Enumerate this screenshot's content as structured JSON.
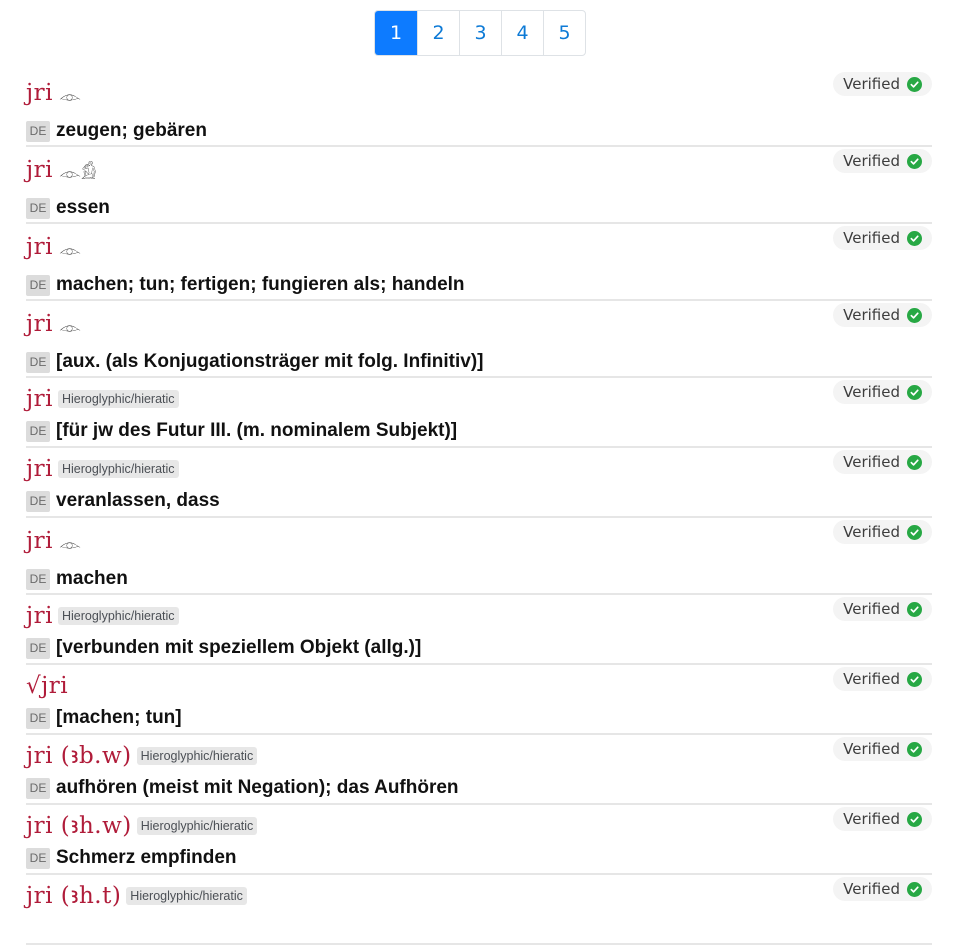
{
  "pagination": {
    "pages": [
      "1",
      "2",
      "3",
      "4",
      "5"
    ],
    "active": "1"
  },
  "status_color": "#27a844",
  "accent_color": "#0d7bff",
  "lemma_color": "#b01c3a",
  "entries": [
    {
      "lemma": "jri",
      "glyphs": "𓁹",
      "badge": "",
      "status": "Verified",
      "lang": "DE",
      "translation": "zeugen; gebären",
      "size": "tall"
    },
    {
      "lemma": "jri",
      "glyphs": "𓁹𓀁",
      "badge": "",
      "status": "Verified",
      "lang": "DE",
      "translation": "essen",
      "size": "tall"
    },
    {
      "lemma": "jri",
      "glyphs": "𓁹",
      "badge": "",
      "status": "Verified",
      "lang": "DE",
      "translation": "machen; tun; fertigen; fungieren als; handeln",
      "size": "tall"
    },
    {
      "lemma": "jri",
      "glyphs": "𓁹",
      "badge": "",
      "status": "Verified",
      "lang": "DE",
      "translation": "[aux. (als Konjugationsträger mit folg. Infinitiv)]",
      "size": "tall"
    },
    {
      "lemma": "jri",
      "glyphs": "",
      "badge": "Hieroglyphic/hieratic",
      "status": "Verified",
      "lang": "DE",
      "translation": "[für jw des Futur III. (m. nominalem Subjekt)]",
      "size": "short"
    },
    {
      "lemma": "jri",
      "glyphs": "",
      "badge": "Hieroglyphic/hieratic",
      "status": "Verified",
      "lang": "DE",
      "translation": "veranlassen, dass",
      "size": "short"
    },
    {
      "lemma": "jri",
      "glyphs": "𓁹",
      "badge": "",
      "status": "Verified",
      "lang": "DE",
      "translation": "machen",
      "size": "tall"
    },
    {
      "lemma": "jri",
      "glyphs": "",
      "badge": "Hieroglyphic/hieratic",
      "status": "Verified",
      "lang": "DE",
      "translation": "[verbunden mit speziellem Objekt (allg.)]",
      "size": "short"
    },
    {
      "lemma": "√jri",
      "glyphs": "",
      "badge": "",
      "status": "Verified",
      "lang": "DE",
      "translation": "[machen; tun]",
      "size": "short"
    },
    {
      "lemma": "jri (ꜣb.w)",
      "glyphs": "",
      "badge": "Hieroglyphic/hieratic",
      "status": "Verified",
      "lang": "DE",
      "translation": "aufhören (meist mit Negation); das Aufhören",
      "size": "short"
    },
    {
      "lemma": "jri (ꜣh.w)",
      "glyphs": "",
      "badge": "Hieroglyphic/hieratic",
      "status": "Verified",
      "lang": "DE",
      "translation": "Schmerz empfinden",
      "size": "short"
    },
    {
      "lemma": "jri (ꜣh.t)",
      "glyphs": "",
      "badge": "Hieroglyphic/hieratic",
      "status": "Verified",
      "lang": "DE",
      "translation": "",
      "size": "short"
    }
  ]
}
